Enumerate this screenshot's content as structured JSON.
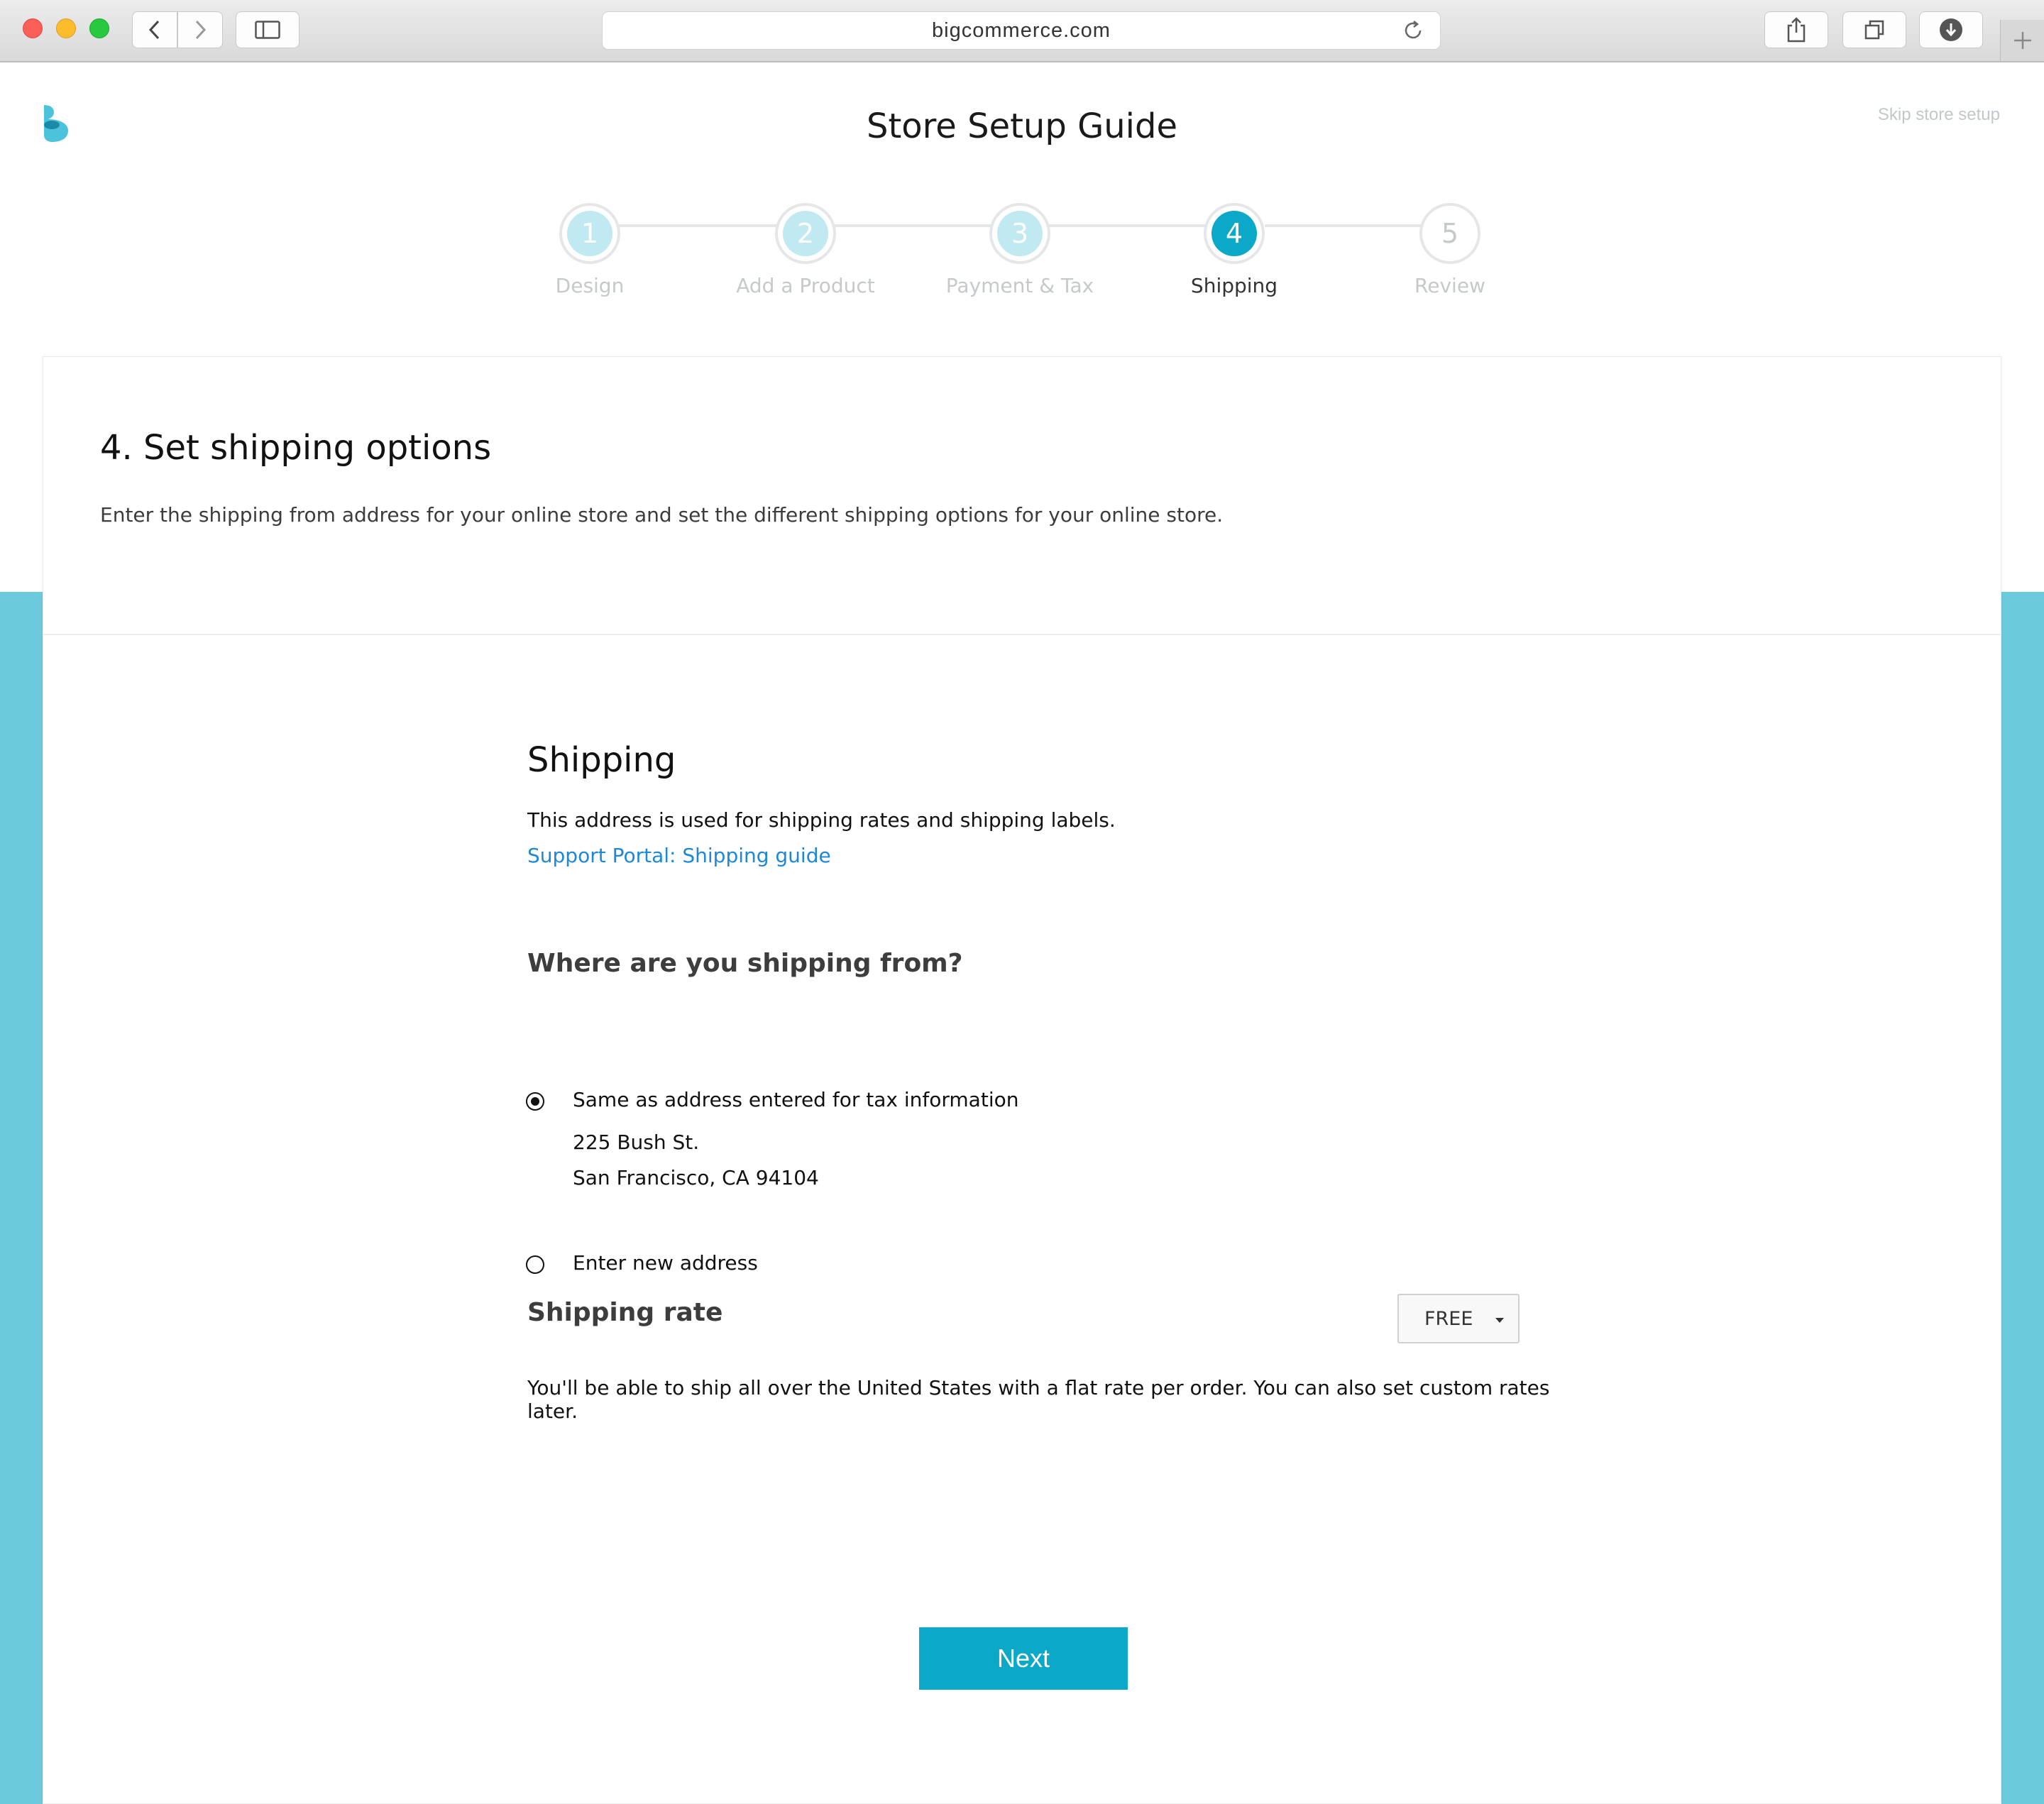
{
  "browser": {
    "url": "bigcommerce.com"
  },
  "header": {
    "title": "Store Setup Guide",
    "skip_label": "Skip store setup"
  },
  "stepper": {
    "steps": [
      {
        "number": "1",
        "label": "Design",
        "state": "done"
      },
      {
        "number": "2",
        "label": "Add a Product",
        "state": "done"
      },
      {
        "number": "3",
        "label": "Payment & Tax",
        "state": "done"
      },
      {
        "number": "4",
        "label": "Shipping",
        "state": "active"
      },
      {
        "number": "5",
        "label": "Review",
        "state": "todo"
      }
    ]
  },
  "card": {
    "title": "4. Set shipping options",
    "description": "Enter the shipping from address for your online store and set the different shipping options for your online store."
  },
  "shipping": {
    "title": "Shipping",
    "text": "This address is used for shipping rates and shipping labels.",
    "link": "Support Portal: Shipping guide",
    "question": "Where are you shipping from?",
    "options": [
      {
        "label": "Same as address entered for tax information",
        "selected": true
      },
      {
        "label": "Enter new address",
        "selected": false
      }
    ],
    "address_line1": "225 Bush St.",
    "address_line2": "San Francisco, CA 94104"
  },
  "rate": {
    "title": "Shipping rate",
    "selected": "FREE",
    "description": "You'll be able to ship all over the United States with a flat rate per order. You can also set custom rates later."
  },
  "actions": {
    "next_label": "Next"
  },
  "colors": {
    "accent": "#0ba8c7",
    "band": "#6ccadd",
    "link": "#1e88d8",
    "step_done": "#c1e9f1"
  }
}
